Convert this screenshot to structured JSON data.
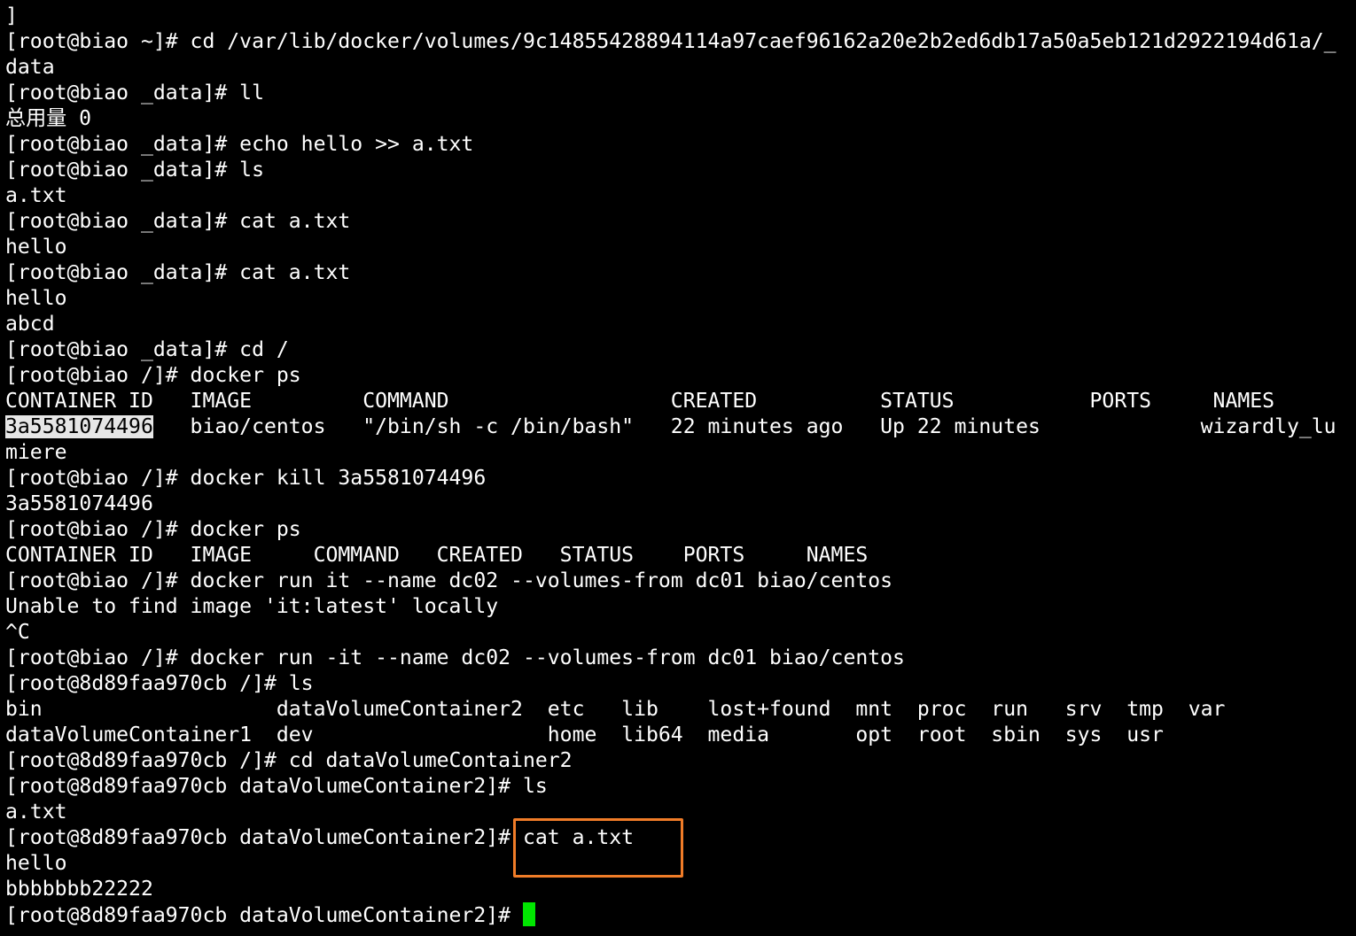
{
  "terminal": {
    "lines": [
      {
        "text": "]"
      },
      {
        "text": "[root@biao ~]# cd /var/lib/docker/volumes/9c14855428894114a97caef96162a20e2b2ed6db17a50a5eb121d2922194d61a/_"
      },
      {
        "text": "data"
      },
      {
        "text": "[root@biao _data]# ll"
      },
      {
        "text": "总用量 0"
      },
      {
        "text": "[root@biao _data]# echo hello >> a.txt"
      },
      {
        "text": "[root@biao _data]# ls"
      },
      {
        "text": "a.txt"
      },
      {
        "text": "[root@biao _data]# cat a.txt"
      },
      {
        "text": "hello"
      },
      {
        "text": "[root@biao _data]# cat a.txt"
      },
      {
        "text": "hello"
      },
      {
        "text": "abcd"
      },
      {
        "text": "[root@biao _data]# cd /"
      },
      {
        "text": "[root@biao /]# docker ps"
      },
      {
        "text": "CONTAINER ID   IMAGE         COMMAND                  CREATED          STATUS           PORTS     NAMES"
      },
      {
        "selected": "3a5581074496",
        "text": "   biao/centos   \"/bin/sh -c /bin/bash\"   22 minutes ago   Up 22 minutes             wizardly_lu"
      },
      {
        "text": "miere"
      },
      {
        "text": "[root@biao /]# docker kill 3a5581074496"
      },
      {
        "text": "3a5581074496"
      },
      {
        "text": "[root@biao /]# docker ps"
      },
      {
        "text": "CONTAINER ID   IMAGE     COMMAND   CREATED   STATUS    PORTS     NAMES"
      },
      {
        "text": "[root@biao /]# docker run it --name dc02 --volumes-from dc01 biao/centos"
      },
      {
        "text": "Unable to find image 'it:latest' locally"
      },
      {
        "text": "^C"
      },
      {
        "text": "[root@biao /]# docker run -it --name dc02 --volumes-from dc01 biao/centos"
      },
      {
        "text": "[root@8d89faa970cb /]# ls"
      },
      {
        "text": "bin                   dataVolumeContainer2  etc   lib    lost+found  mnt  proc  run   srv  tmp  var"
      },
      {
        "text": "dataVolumeContainer1  dev                   home  lib64  media       opt  root  sbin  sys  usr"
      },
      {
        "text": "[root@8d89faa970cb /]# cd dataVolumeContainer2"
      },
      {
        "text": "[root@8d89faa970cb dataVolumeContainer2]# ls"
      },
      {
        "text": "a.txt"
      },
      {
        "text": "[root@8d89faa970cb dataVolumeContainer2]# cat a.txt"
      },
      {
        "text": "hello"
      },
      {
        "text": "bbbbbbb22222"
      },
      {
        "text": "[root@8d89faa970cb dataVolumeContainer2]# ",
        "cursor": true
      }
    ],
    "cursor_color": "#00e600",
    "annotation_color": "#f07c28"
  }
}
